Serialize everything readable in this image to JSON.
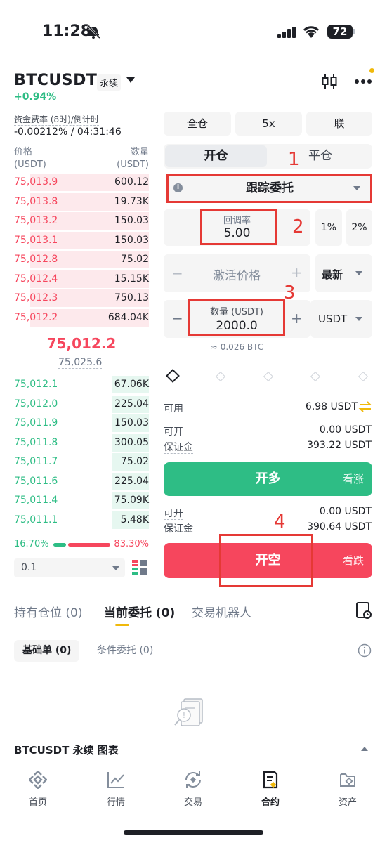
{
  "status_bar": {
    "time": "11:28",
    "battery": "72"
  },
  "header": {
    "symbol": "BTCUSDT",
    "contract_type": "永续",
    "change": "+0.94%",
    "funding_label": "资金费率 (8时)/倒计时",
    "funding_value": "-0.00212% / 04:31:46"
  },
  "orderbook": {
    "price_header": "价格",
    "price_unit": "(USDT)",
    "qty_header": "数量",
    "qty_unit": "(USDT)",
    "asks": [
      {
        "price": "75,013.9",
        "qty": "600.12",
        "depth": 0.88
      },
      {
        "price": "75,013.8",
        "qty": "19.73K",
        "depth": 0.88
      },
      {
        "price": "75,013.2",
        "qty": "150.03",
        "depth": 0.88
      },
      {
        "price": "75,013.1",
        "qty": "150.03",
        "depth": 0.88
      },
      {
        "price": "75,012.8",
        "qty": "75.02",
        "depth": 0.88
      },
      {
        "price": "75,012.4",
        "qty": "15.15K",
        "depth": 0.88
      },
      {
        "price": "75,012.3",
        "qty": "750.13",
        "depth": 0.88
      },
      {
        "price": "75,012.2",
        "qty": "684.04K",
        "depth": 0.88
      }
    ],
    "last_price": "75,012.2",
    "mark_price": "75,025.6",
    "bids": [
      {
        "price": "75,012.1",
        "qty": "67.06K",
        "depth": 0.27
      },
      {
        "price": "75,012.0",
        "qty": "225.04",
        "depth": 0.27
      },
      {
        "price": "75,011.9",
        "qty": "150.03",
        "depth": 0.27
      },
      {
        "price": "75,011.8",
        "qty": "300.05",
        "depth": 0.27
      },
      {
        "price": "75,011.7",
        "qty": "75.02",
        "depth": 0.27
      },
      {
        "price": "75,011.6",
        "qty": "225.04",
        "depth": 0.27
      },
      {
        "price": "75,011.4",
        "qty": "75.09K",
        "depth": 0.27
      },
      {
        "price": "75,011.1",
        "qty": "5.48K",
        "depth": 0.27
      }
    ],
    "buy_ratio": "16.70%",
    "sell_ratio": "83.30%",
    "precision": "0.1"
  },
  "order_panel": {
    "margin_mode": "全仓",
    "leverage": "5x",
    "asset_mode": "联",
    "tab_open": "开仓",
    "tab_close": "平仓",
    "order_type": "跟踪委托",
    "callback_label": "回调率",
    "callback_value": "5.00",
    "pct_1": "1%",
    "pct_2": "2%",
    "activation_placeholder": "激活价格",
    "price_source": "最新",
    "qty_label": "数量 (USDT)",
    "qty_value": "2000.0",
    "qty_unit": "USDT",
    "qty_btc": "≈ 0.026 BTC",
    "available_label": "可用",
    "available_value": "6.98 USDT",
    "long_can_open_label": "可开",
    "long_can_open_value": "0.00 USDT",
    "long_margin_label": "保证金",
    "long_margin_value": "393.22 USDT",
    "long_button": "开多",
    "long_sub": "看涨",
    "short_can_open_label": "可开",
    "short_can_open_value": "0.00 USDT",
    "short_margin_label": "保证金",
    "short_margin_value": "390.64 USDT",
    "short_button": "开空",
    "short_sub": "看跌",
    "minus": "−",
    "plus": "+"
  },
  "annotations": [
    "1",
    "2",
    "3",
    "4"
  ],
  "positions": {
    "tabs": [
      "持有仓位 (0)",
      "当前委托 (0)",
      "交易机器人"
    ],
    "sub_tabs": [
      "基础单 (0)",
      "条件委托 (0)"
    ],
    "chart_bar": "BTCUSDT 永续 图表"
  },
  "nav": {
    "items": [
      {
        "label": "首页",
        "icon": "binance-logo-icon"
      },
      {
        "label": "行情",
        "icon": "market-chart-icon"
      },
      {
        "label": "交易",
        "icon": "trade-icon"
      },
      {
        "label": "合约",
        "icon": "futures-icon"
      },
      {
        "label": "资产",
        "icon": "wallet-icon"
      }
    ]
  },
  "colors": {
    "green": "#2ebd85",
    "red": "#f6465d",
    "accent": "#f0b90b",
    "annotation": "#e53935"
  }
}
